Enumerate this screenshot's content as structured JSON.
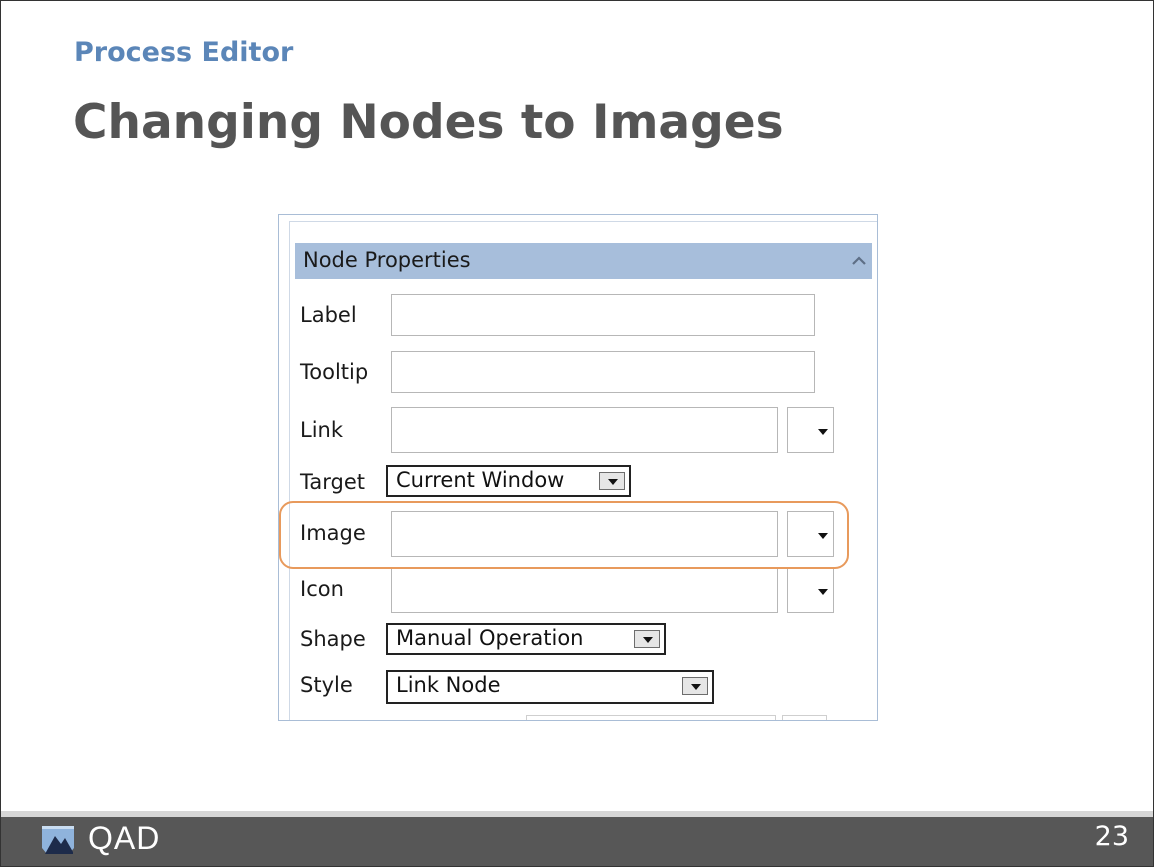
{
  "slide": {
    "kicker": "Process Editor",
    "title": "Changing Nodes to Images",
    "page_number": "23"
  },
  "panel": {
    "header": "Node Properties",
    "fields": {
      "label": {
        "label": "Label",
        "value": ""
      },
      "tooltip": {
        "label": "Tooltip",
        "value": ""
      },
      "link": {
        "label": "Link",
        "value": ""
      },
      "target": {
        "label": "Target",
        "value": "Current Window"
      },
      "image": {
        "label": "Image",
        "value": ""
      },
      "icon": {
        "label": "Icon",
        "value": ""
      },
      "shape": {
        "label": "Shape",
        "value": "Manual Operation"
      },
      "style": {
        "label": "Style",
        "value": "Link Node"
      }
    }
  },
  "footer": {
    "logo_text": "QAD",
    "logo_icon": "qad-logo-icon"
  },
  "colors": {
    "kicker": "#5b86b8",
    "title": "#555555",
    "panel_header": "#a7bedb",
    "highlight": "#e89a5c",
    "footer": "#575757"
  }
}
